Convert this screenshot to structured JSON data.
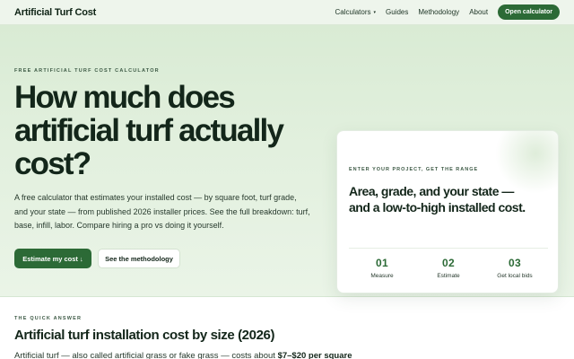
{
  "nav": {
    "brand": "Artificial Turf Cost",
    "links": [
      {
        "label": "Calculators",
        "caret": "▾"
      },
      {
        "label": "Guides"
      },
      {
        "label": "Methodology"
      },
      {
        "label": "About"
      }
    ],
    "cta": "Open calculator"
  },
  "hero": {
    "eyebrow": "FREE ARTIFICIAL TURF COST CALCULATOR",
    "title": "How much does artificial turf actually cost?",
    "lead": "A free calculator that estimates your installed cost — by square foot, turf grade, and your state — from published 2026 installer prices. See the full breakdown: turf, base, infill, labor. Compare hiring a pro vs doing it yourself.",
    "primary_button": "Estimate my cost ↓",
    "secondary_button": "See the methodology"
  },
  "card": {
    "eyebrow": "ENTER YOUR PROJECT, GET THE RANGE",
    "title": "Area, grade, and your state — and a low-to-high installed cost.",
    "steps": [
      {
        "num": "01",
        "label": "Measure"
      },
      {
        "num": "02",
        "label": "Estimate"
      },
      {
        "num": "03",
        "label": "Get local bids"
      }
    ]
  },
  "quick_answer": {
    "eyebrow": "THE QUICK ANSWER",
    "title": "Artificial turf installation cost by size (2026)",
    "body_start": "Artificial turf — also called artificial grass or fake grass — costs about ",
    "body_strong": "$7–$20 per square"
  },
  "colors": {
    "accent": "#2c6a36",
    "hero_bg": "#dcedd7",
    "text": "#13261a"
  }
}
